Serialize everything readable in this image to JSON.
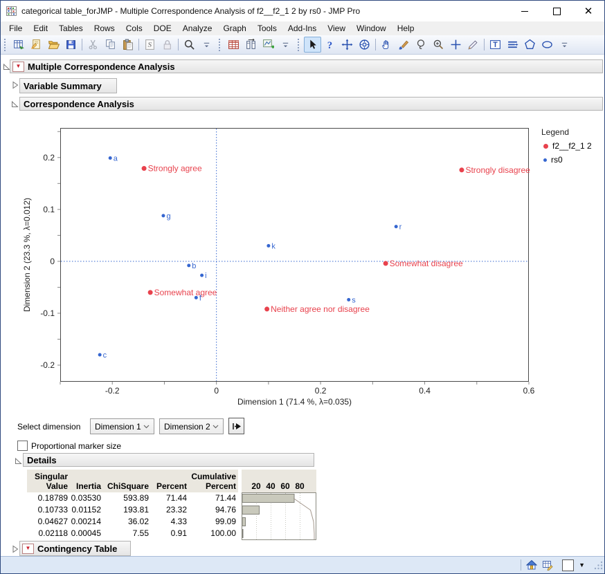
{
  "window": {
    "title": "categorical table_forJMP - Multiple Correspondence Analysis of f2__f2_1 2 by rs0 - JMP Pro"
  },
  "menu": {
    "items": [
      "File",
      "Edit",
      "Tables",
      "Rows",
      "Cols",
      "DOE",
      "Analyze",
      "Graph",
      "Tools",
      "Add-Ins",
      "View",
      "Window",
      "Help"
    ]
  },
  "toolbar": {
    "groups": [
      [
        "new-data-table-icon",
        "new-journal-icon",
        "open-icon",
        "save-icon",
        "separator",
        "cut-icon",
        "copy-icon",
        "paste-icon",
        "separator",
        "script-icon",
        "lock-icon",
        "separator",
        "search-icon",
        "overflow-icon"
      ],
      [
        "data-table-icon",
        "column-info-icon",
        "graph-builder-icon",
        "overflow-icon"
      ],
      [
        "arrow-tool-icon",
        "help-tool-icon",
        "move-tool-icon",
        "bullseye-tool-icon",
        "separator",
        "hand-tool-icon",
        "brush-tool-icon",
        "lasso-tool-icon",
        "magnifier-tool-icon",
        "crosshair-tool-icon",
        "pencil-tool-icon",
        "separator",
        "text-annotate-icon",
        "line-annotate-icon",
        "polygon-annotate-icon",
        "oval-annotate-icon",
        "overflow-icon"
      ]
    ],
    "selected_tool": "arrow-tool-icon"
  },
  "outline": {
    "mca": "Multiple Correspondence Analysis",
    "variable_summary": "Variable Summary",
    "correspondence_analysis": "Correspondence Analysis",
    "details": "Details",
    "contingency_table": "Contingency Table"
  },
  "controls": {
    "select_dimension_label": "Select dimension",
    "dimension_x": "Dimension 1",
    "dimension_y": "Dimension 2",
    "proportional_marker_label": "Proportional marker size",
    "proportional_checked": false
  },
  "legend": {
    "title": "Legend",
    "entries": [
      {
        "label": "f2__f2_1 2",
        "color": "#e8424d",
        "size": 7
      },
      {
        "label": "rs0",
        "color": "#3566d0",
        "size": 5
      }
    ]
  },
  "chart_data": {
    "type": "scatter",
    "title": "",
    "xlabel": "Dimension 1 (71.4 %, λ=0.035)",
    "ylabel": "Dimension 2  (23.3 %, λ=0.012)",
    "xlim": [
      -0.3,
      0.6
    ],
    "ylim": [
      -0.232,
      0.257
    ],
    "x_tick_labels": [
      "-0.2",
      "0",
      "0.2",
      "0.4",
      "0.6"
    ],
    "y_tick_labels": [
      "0.2",
      "0.1",
      "0",
      "-0.1",
      "-0.2"
    ],
    "grid": false,
    "legend_position": "right",
    "reference_lines": {
      "x": 0,
      "y": 0,
      "color": "#3566d0",
      "style": "dotted"
    },
    "series": [
      {
        "name": "f2__f2_1 2",
        "color": "#e8424d",
        "marker_radius": 3.5,
        "label_font_px": 12,
        "points": [
          {
            "label": "Strongly agree",
            "x": -0.139,
            "y": 0.179
          },
          {
            "label": "Somewhat agree",
            "x": -0.127,
            "y": -0.06
          },
          {
            "label": "Neither agree nor disagree",
            "x": 0.097,
            "y": -0.092
          },
          {
            "label": "Somewhat disagree",
            "x": 0.325,
            "y": -0.004
          },
          {
            "label": "Strongly disagree",
            "x": 0.471,
            "y": 0.176
          }
        ]
      },
      {
        "name": "rs0",
        "color": "#3566d0",
        "marker_radius": 2.5,
        "label_font_px": 11,
        "points": [
          {
            "label": "a",
            "x": -0.204,
            "y": 0.199
          },
          {
            "label": "g",
            "x": -0.102,
            "y": 0.088
          },
          {
            "label": "b",
            "x": -0.053,
            "y": -0.008
          },
          {
            "label": "i",
            "x": -0.028,
            "y": -0.027
          },
          {
            "label": "f",
            "x": -0.039,
            "y": -0.07
          },
          {
            "label": "c",
            "x": -0.224,
            "y": -0.18
          },
          {
            "label": "k",
            "x": 0.1,
            "y": 0.03
          },
          {
            "label": "r",
            "x": 0.345,
            "y": 0.067
          },
          {
            "label": "s",
            "x": 0.254,
            "y": -0.074
          }
        ]
      }
    ]
  },
  "details_table": {
    "columns": [
      "Singular\nValue",
      "Inertia",
      "ChiSquare",
      "Percent",
      "Cumulative\nPercent"
    ],
    "bar_axis_ticks": [
      20,
      40,
      60,
      80
    ],
    "rows": [
      {
        "singular_value": "0.18789",
        "inertia": "0.03530",
        "chi_square": "593.89",
        "percent": "71.44",
        "cumulative_percent": "71.44"
      },
      {
        "singular_value": "0.10733",
        "inertia": "0.01152",
        "chi_square": "193.81",
        "percent": "23.32",
        "cumulative_percent": "94.76"
      },
      {
        "singular_value": "0.04627",
        "inertia": "0.00214",
        "chi_square": "36.02",
        "percent": "4.33",
        "cumulative_percent": "99.09"
      },
      {
        "singular_value": "0.02118",
        "inertia": "0.00045",
        "chi_square": "7.55",
        "percent": "0.91",
        "cumulative_percent": "100.00"
      }
    ]
  },
  "colors": {
    "accent_red": "#e8424d",
    "accent_blue": "#3566d0"
  }
}
